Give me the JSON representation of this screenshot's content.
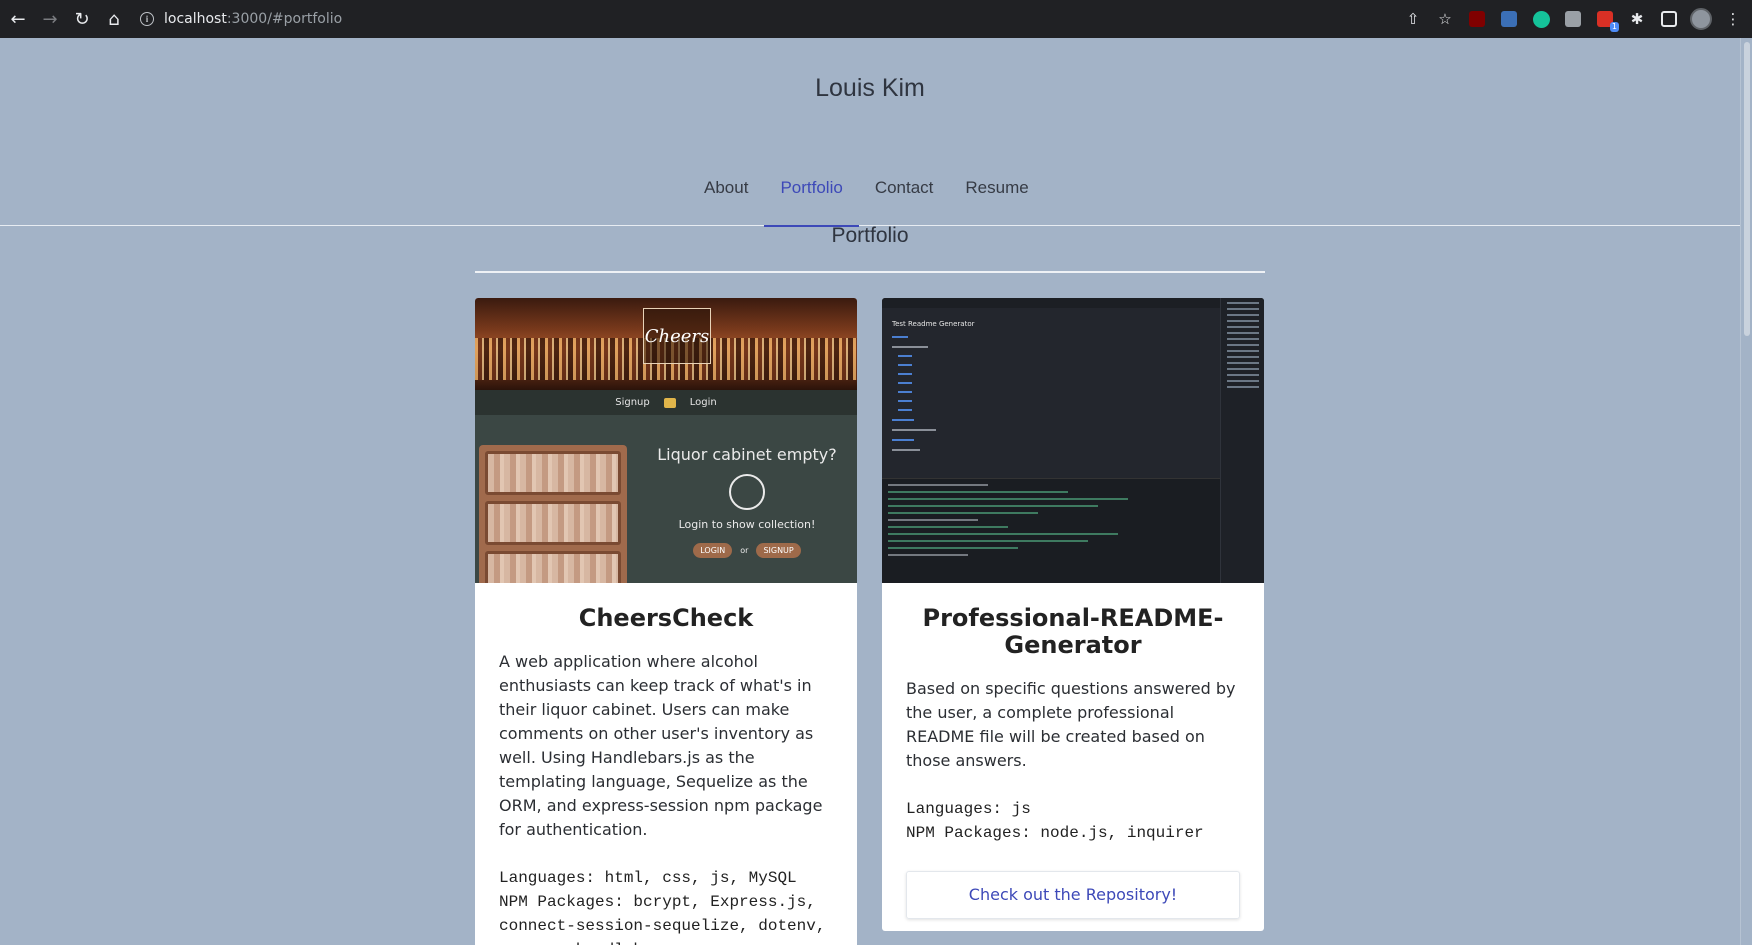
{
  "browser": {
    "url_host": "localhost",
    "url_rest": ":3000/#portfolio",
    "extension_badge": "1"
  },
  "site": {
    "title": "Louis Kim",
    "nav": [
      {
        "label": "About",
        "active": false
      },
      {
        "label": "Portfolio",
        "active": true
      },
      {
        "label": "Contact",
        "active": false
      },
      {
        "label": "Resume",
        "active": false
      }
    ]
  },
  "portfolio": {
    "heading": "Portfolio",
    "projects": [
      {
        "title": "CheersCheck",
        "description": "A web application where alcohol enthusiasts can keep track of what's in their liquor cabinet. Users can make comments on other user's inventory as well. Using Handlebars.js as the templating language, Sequelize as the ORM, and express-session npm package for authentication.",
        "tech": "Languages: html, css, js, MySQL\nNPM Packages: bcrypt, Express.js, connect-session-sequelize, dotenv, express-handlebars, express-",
        "screenshot": {
          "logo": "Cheers",
          "signup": "Signup",
          "login": "Login",
          "headline": "Liquor cabinet empty?",
          "subline": "Login to show collection!",
          "btn_login": "LOGIN",
          "btn_or": "or",
          "btn_signup": "SIGNUP"
        }
      },
      {
        "title": "Professional-README-Generator",
        "description": "Based on specific questions answered by the user, a complete professional README file will be created based on those answers.",
        "tech": "Languages: js\nNPM Packages: node.js, inquirer",
        "repo_label": "Check out the Repository!",
        "screenshot": {
          "doc_title": "Test Readme Generator"
        }
      }
    ]
  }
}
